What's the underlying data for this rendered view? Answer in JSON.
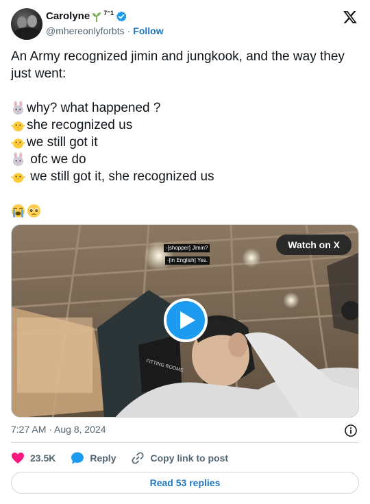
{
  "author": {
    "display_name": "Carolyne",
    "name_suffix": "7⁼1",
    "handle": "@mhereonlyforbts",
    "separator": "·",
    "follow_label": "Follow",
    "verified": true
  },
  "platform_logo": "x-logo-icon",
  "tweet": {
    "line1": "An Army recognized jimin and jungkook, and the way they",
    "line2": "just went:",
    "dialogue": [
      {
        "emoji": "bunny-emoji-icon",
        "text": "why? what happened ?"
      },
      {
        "emoji": "chick-emoji-icon",
        "text": "she recognized us"
      },
      {
        "emoji": "chick-emoji-icon",
        "text": "we still got it"
      },
      {
        "emoji": "bunny-emoji-icon",
        "text": " ofc we do"
      },
      {
        "emoji": "chick-emoji-icon",
        "text": " we still got it, she recognized us"
      }
    ],
    "reaction_emojis": [
      "loudly-crying-face-emoji-icon",
      "pleading-face-emoji-icon"
    ]
  },
  "media": {
    "subtitle_1": "-[shopper] Jimin?",
    "subtitle_2": "-[in English] Yes.",
    "watch_label": "Watch on X",
    "sign_text": "FITTING ROOMS"
  },
  "timestamp": "7:27 AM · Aug 8, 2024",
  "actions": {
    "likes": "23.5K",
    "reply_label": "Reply",
    "copy_label": "Copy link to post"
  },
  "read_replies_label": "Read 53 replies",
  "colors": {
    "link": "#1d77c2",
    "play_button": "#1d9bf0",
    "heart": "#f91880",
    "reply_bubble": "#1d9bf0",
    "muted_text": "#536471"
  }
}
